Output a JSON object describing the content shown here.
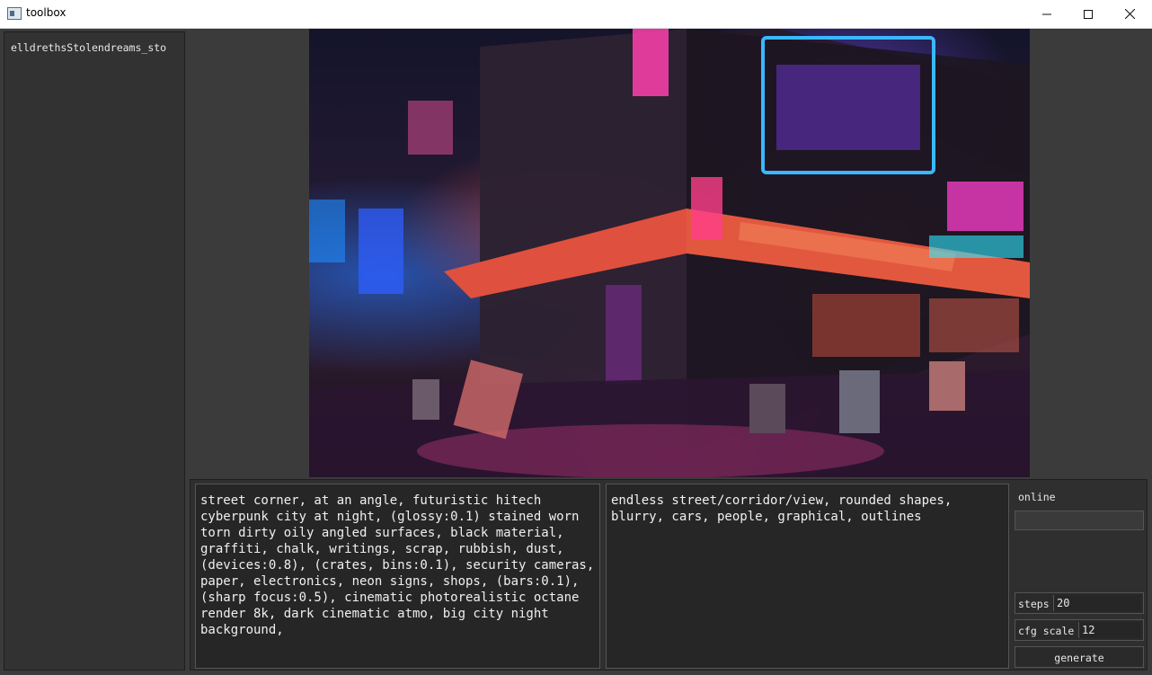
{
  "window": {
    "title": "toolbox",
    "icon": "app-window-icon",
    "controls": {
      "minimize": "—",
      "maximize": "☐",
      "close": "✕"
    }
  },
  "sidebar": {
    "items": [
      {
        "label": "elldrethsStolendreams_sto"
      }
    ]
  },
  "image_panel": {
    "description_icon": "generated-image"
  },
  "prompt": {
    "value": "street corner, at an angle, futuristic hitech cyberpunk city at night, (glossy:0.1) stained worn torn dirty oily angled surfaces, black material, graffiti, chalk, writings, scrap, rubbish, dust, (devices:0.8), (crates, bins:0.1), security cameras, paper, electronics, neon signs, shops, (bars:0.1), (sharp focus:0.5), cinematic photorealistic octane render 8k, dark cinematic atmo, big city night background,"
  },
  "negative_prompt": {
    "value": "endless street/corridor/view, rounded shapes, blurry, cars, people, graphical, outlines"
  },
  "status": {
    "label": "online",
    "value": ""
  },
  "params": {
    "steps_label": "steps",
    "steps_value": "20",
    "cfg_label": "cfg scale",
    "cfg_value": "12"
  },
  "generate": {
    "label": "generate"
  }
}
